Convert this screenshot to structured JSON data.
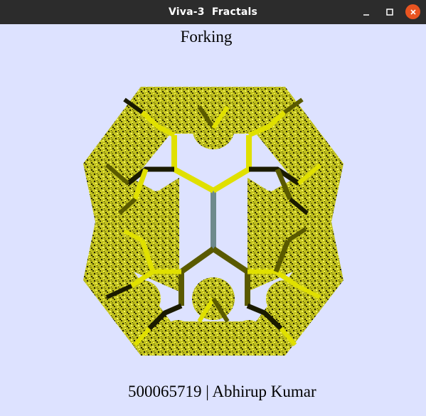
{
  "window": {
    "title": "Viva-3  Fractals"
  },
  "canvas": {
    "heading": "Forking",
    "footer": "500065719 | Abhirup Kumar"
  },
  "colors": {
    "background": "#dde2ff",
    "titlebar": "#2c2c2c",
    "close_button": "#e95420",
    "trunk": "#6e8a8c",
    "branch_yellow": "#e0e000",
    "branch_olive": "#5a5a00",
    "branch_dark": "#1a1a00"
  }
}
